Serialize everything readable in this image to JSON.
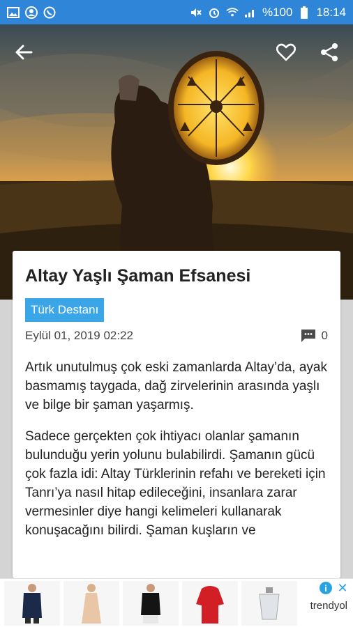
{
  "status_bar": {
    "battery_text": "%100",
    "time": "18:14"
  },
  "article": {
    "title": "Altay Yaşlı Şaman Efsanesi",
    "tag": "Türk Destanı",
    "date": "Eylül 01, 2019 02:22",
    "comment_count": "0",
    "paragraphs": [
      "Artık unutulmuş çok eski zamanlarda Altay’da, ayak basmamış taygada, dağ zirvelerinin arasında yaşlı ve bilge bir şaman yaşarmış.",
      "Sadece gerçekten çok ihtiyacı olanlar şamanın bulunduğu yerin yolunu bulabilirdi. Şamanın gücü çok fazla idi: Altay Türklerinin refahı ve bereketi için Tanrı’ya nasıl hitap edileceğini, insanlara zarar vermesinler diye hangi kelimeleri kullanarak konuşacağını bilirdi. Şaman kuşların ve"
    ]
  },
  "ad": {
    "brand": "trendyol"
  },
  "colors": {
    "status_bar": "#2f86d9",
    "tag_bg": "#3aa6e8",
    "card_bg": "#ffffff"
  },
  "icons": [
    "back-arrow-icon",
    "heart-icon",
    "share-icon",
    "comment-icon",
    "ad-info-icon",
    "ad-close-icon"
  ]
}
